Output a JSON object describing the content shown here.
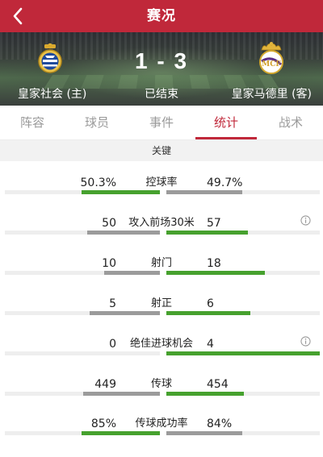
{
  "header": {
    "title": "赛况",
    "back_icon": "chevron-left-icon"
  },
  "match": {
    "home_team": "皇家社会 (主)",
    "away_team": "皇家马德里 (客)",
    "score": "1 - 3",
    "status": "已结束",
    "home_crest_icon": "real-sociedad-crest-icon",
    "away_crest_icon": "real-madrid-crest-icon"
  },
  "tabs": [
    {
      "label": "阵容",
      "active": false
    },
    {
      "label": "球员",
      "active": false
    },
    {
      "label": "事件",
      "active": false
    },
    {
      "label": "统计",
      "active": true
    },
    {
      "label": "战术",
      "active": false
    }
  ],
  "section_title": "关键",
  "colors": {
    "brand": "#c0283a",
    "leader_bar": "#46a12e",
    "trailer_bar": "#9b9b9b",
    "track": "#eeeeee"
  },
  "stats": [
    {
      "label": "控球率",
      "home": "50.3%",
      "away": "49.7%",
      "home_share": 0.503,
      "away_share": 0.497,
      "info": false
    },
    {
      "label": "攻入前场30米",
      "home": "50",
      "away": "57",
      "home_share": 0.467,
      "away_share": 0.533,
      "info": true
    },
    {
      "label": "射门",
      "home": "10",
      "away": "18",
      "home_share": 0.357,
      "away_share": 0.643,
      "info": false
    },
    {
      "label": "射正",
      "home": "5",
      "away": "6",
      "home_share": 0.455,
      "away_share": 0.545,
      "info": false
    },
    {
      "label": "绝佳进球机会",
      "home": "0",
      "away": "4",
      "home_share": 0.0,
      "away_share": 1.0,
      "info": true
    },
    {
      "label": "传球",
      "home": "449",
      "away": "454",
      "home_share": 0.497,
      "away_share": 0.503,
      "info": false
    },
    {
      "label": "传球成功率",
      "home": "85%",
      "away": "84%",
      "home_share": 0.503,
      "away_share": 0.497,
      "info": false
    }
  ]
}
